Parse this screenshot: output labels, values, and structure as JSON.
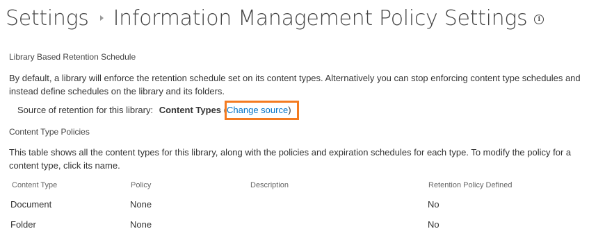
{
  "header": {
    "breadcrumb_root": "Settings",
    "page_title": "Information Management Policy Settings"
  },
  "retention": {
    "heading": "Library Based Retention Schedule",
    "description": "By default, a library will enforce the retention schedule set on its content types. Alternatively you can stop enforcing content type schedules and instead define schedules on the library and its folders.",
    "source_label": "Source of retention for this library:",
    "source_value": "Content Types",
    "change_source_link": "Change source",
    "paren_open": "(",
    "paren_close": ")"
  },
  "content_type_policies": {
    "heading": "Content Type Policies",
    "description": "This table shows all the content types for this library, along with the policies and expiration schedules for each type. To modify the policy for a content type, click its name.",
    "columns": [
      "Content Type",
      "Policy",
      "Description",
      "Retention Policy Defined"
    ],
    "rows": [
      {
        "content_type": "Document",
        "policy": "None",
        "description": "",
        "retention_defined": "No"
      },
      {
        "content_type": "Folder",
        "policy": "None",
        "description": "",
        "retention_defined": "No"
      }
    ]
  },
  "colors": {
    "link": "#0072c6",
    "highlight": "#f47b20"
  },
  "icons": {
    "info": "info-circle-icon",
    "breadcrumb_separator": "triangle-right-icon"
  }
}
